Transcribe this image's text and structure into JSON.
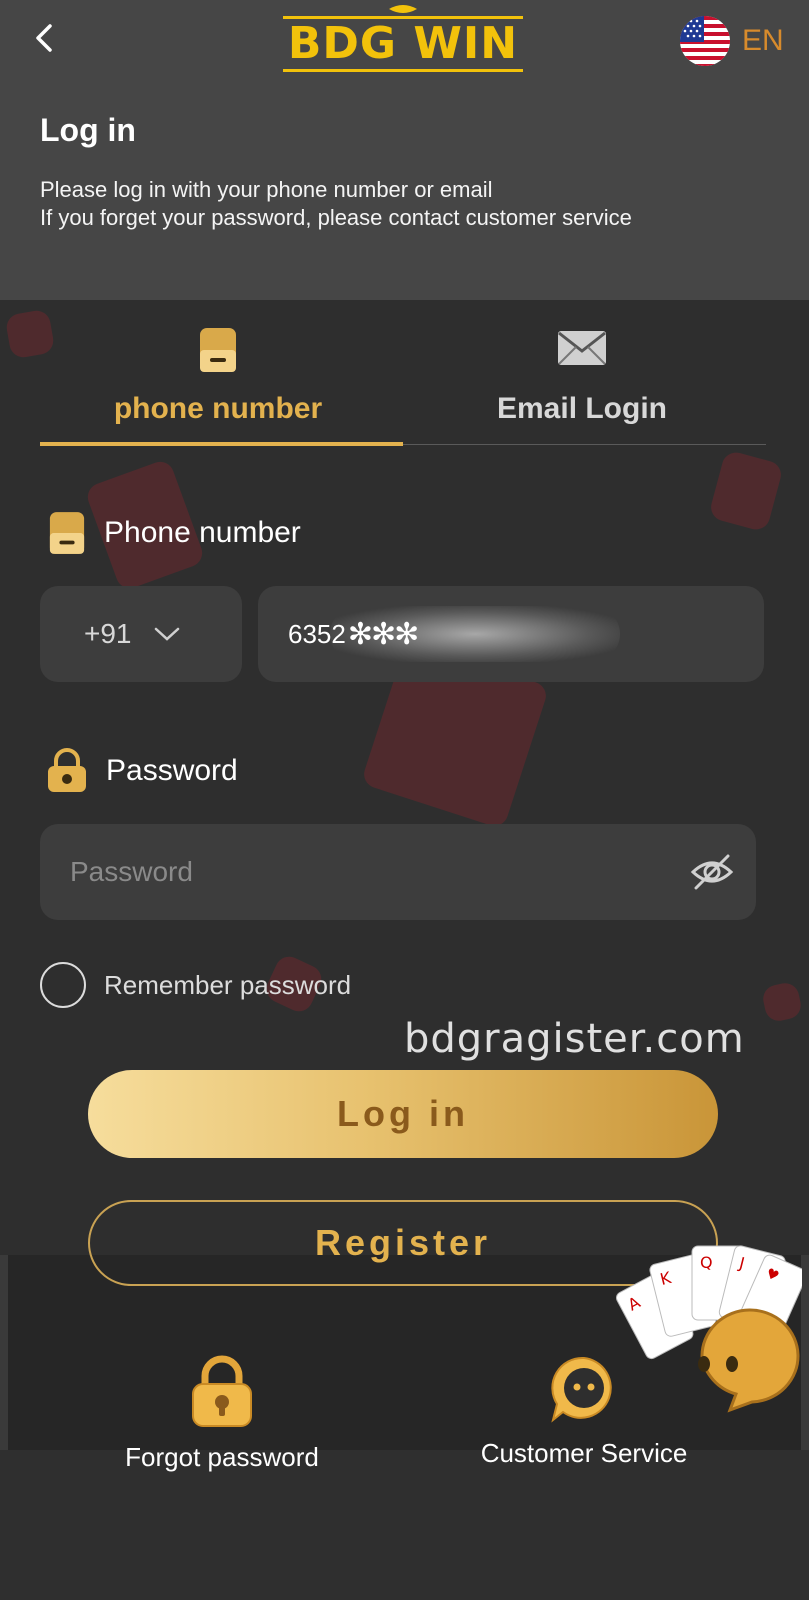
{
  "header": {
    "logo_text": "BDG WIN",
    "language": "EN"
  },
  "title": "Log in",
  "subtitle": {
    "line1": "Please log in with your phone number or email",
    "line2": "If you forget your password, please contact customer service"
  },
  "tabs": [
    {
      "label": "phone number",
      "active": true,
      "icon": "phone-icon"
    },
    {
      "label": "Email Login",
      "active": false,
      "icon": "envelope-icon"
    }
  ],
  "phone": {
    "label": "Phone number",
    "country_code": "+91",
    "value": "6352"
  },
  "password": {
    "label": "Password",
    "placeholder": "Password"
  },
  "remember_label": "Remember password",
  "watermark": "bdgragister.com",
  "buttons": {
    "login": "Log in",
    "register": "Register"
  },
  "bottom_links": {
    "forgot": "Forgot password",
    "service": "Customer Service"
  },
  "colors": {
    "accent_gold": "#e3b24e",
    "logo_yellow": "#f2c20b",
    "lang_orange": "#d88b2c",
    "field_bg": "#3d3d3d"
  }
}
